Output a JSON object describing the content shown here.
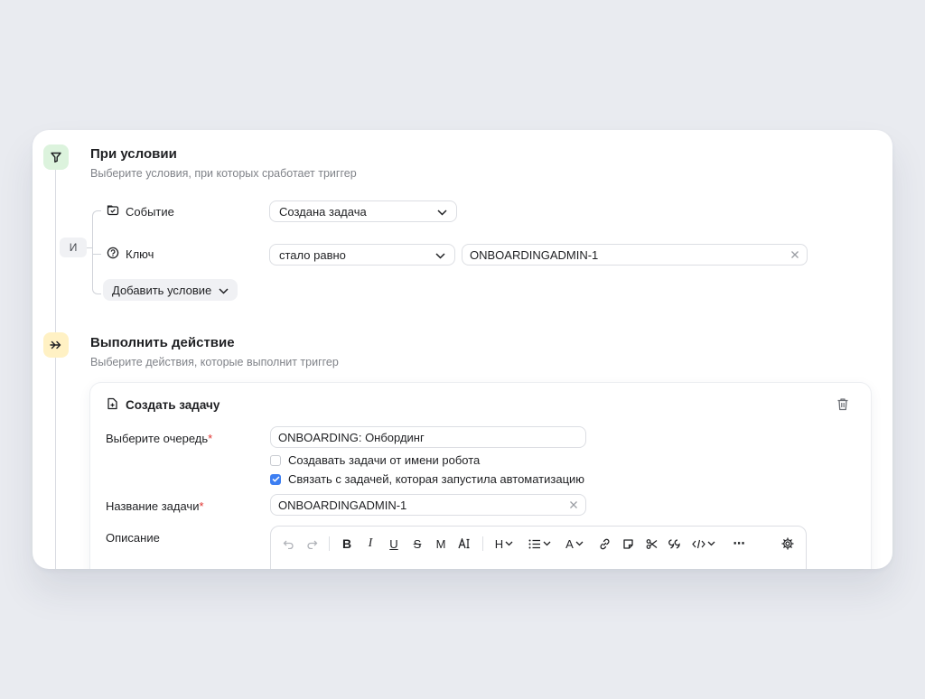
{
  "condition_section": {
    "title": "При условии",
    "subtitle": "Выберите условия, при которых сработает триггер",
    "and_badge": "И",
    "rows": [
      {
        "label": "Событие",
        "icon": "event-icon",
        "select_value": "Создана задача"
      },
      {
        "label": "Ключ",
        "icon": "question-icon",
        "select_value": "стало равно",
        "input_value": "ONBOARDINGADMIN-1"
      }
    ],
    "add_condition_label": "Добавить условие"
  },
  "action_section": {
    "title": "Выполнить действие",
    "subtitle": "Выберите действия, которые выполнит триггер",
    "card": {
      "title": "Создать задачу",
      "queue_label": "Выберите очередь",
      "required_mark": "*",
      "queue_value": "ONBOARDING: Онбординг",
      "checkbox_robot": {
        "label": "Создавать задачи от имени робота",
        "checked": false
      },
      "checkbox_link": {
        "label": "Связать с задачей, которая запустила автоматизацию",
        "checked": true
      },
      "task_name_label": "Название задачи",
      "task_name_value": "ONBOARDINGADMIN-1",
      "description_label": "Описание",
      "toolbar": {
        "heading": "H",
        "text_color": "A",
        "more": "⋯"
      }
    }
  },
  "colors": {
    "accent_checkbox": "#3d7ff2",
    "required": "#e0332f",
    "condition_icon_bg": "#dcf3dd",
    "action_icon_bg": "#fff1c4"
  }
}
